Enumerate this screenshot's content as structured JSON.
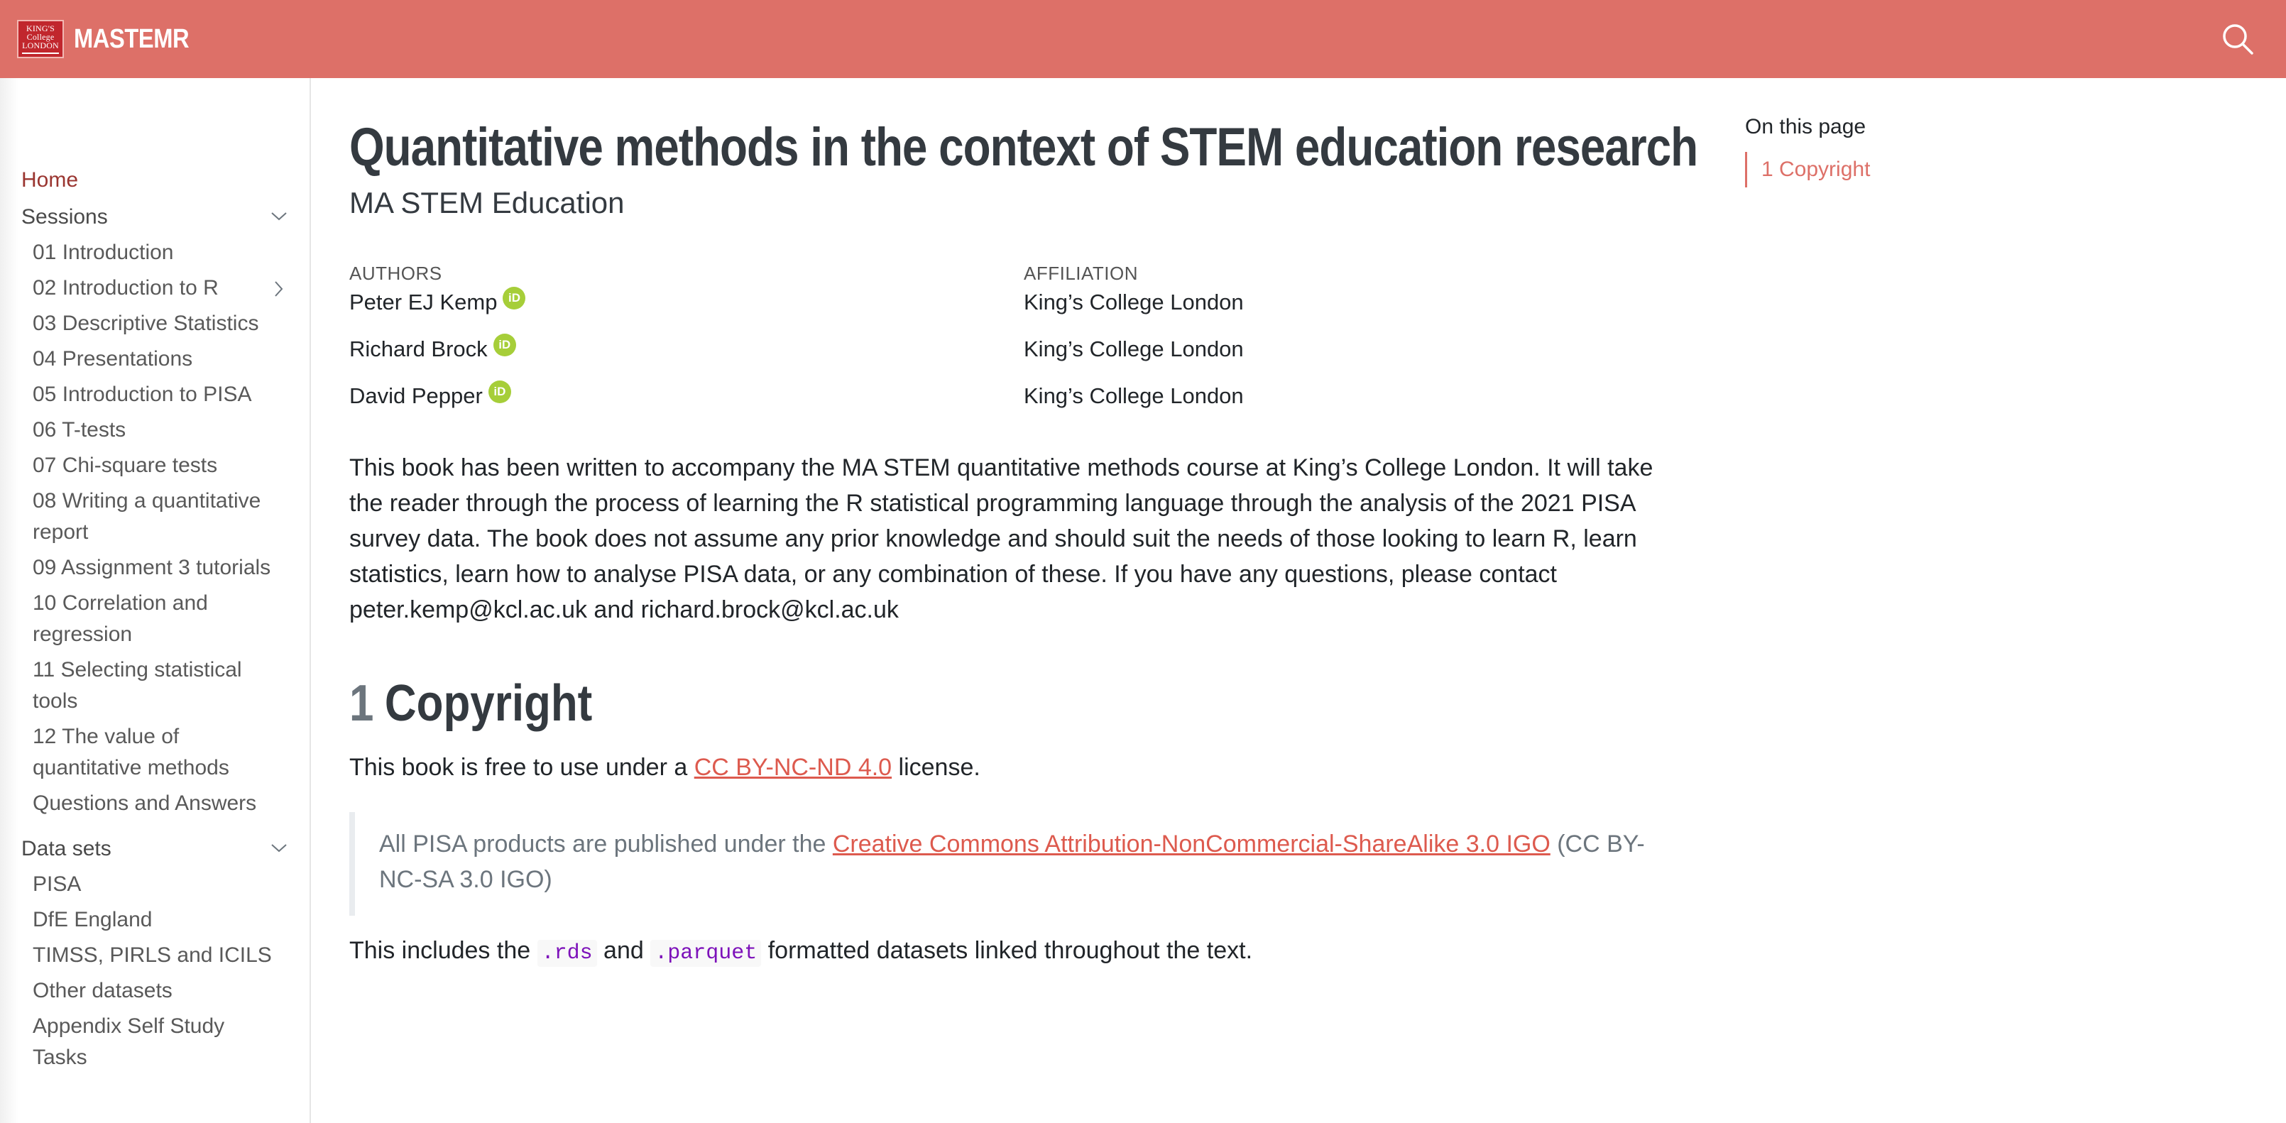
{
  "navbar": {
    "logo_lines": [
      "KING'S",
      "College",
      "LONDON"
    ],
    "brand": "MASTEMR",
    "search_icon": "search-icon"
  },
  "sidebar": {
    "home": "Home",
    "sessions_label": "Sessions",
    "sessions": [
      "01 Introduction",
      "02 Introduction to R",
      "03 Descriptive Statistics",
      "04 Presentations",
      "05 Introduction to PISA",
      "06 T-tests",
      "07 Chi-square tests",
      "08 Writing a quantitative report",
      "09 Assignment 3 tutorials",
      "10 Correlation and regression",
      "11 Selecting statistical tools",
      "12 The value of quantitative methods",
      "Questions and Answers"
    ],
    "datasets_label": "Data sets",
    "datasets": [
      "PISA",
      "DfE England",
      "TIMSS, PIRLS and ICILS",
      "Other datasets",
      "Appendix Self Study Tasks"
    ]
  },
  "main": {
    "title": "Quantitative methods in the context of STEM education research",
    "subtitle": "MA STEM Education",
    "authors_heading": "AUTHORS",
    "affiliation_heading": "AFFILIATION",
    "authors": [
      {
        "name": "Peter EJ Kemp",
        "affiliation": "King’s College London"
      },
      {
        "name": "Richard Brock",
        "affiliation": "King’s College London"
      },
      {
        "name": "David Pepper",
        "affiliation": "King’s College London"
      }
    ],
    "orcid_label": "iD",
    "intro": "This book has been written to accompany the MA STEM quantitative methods course at King’s College London. It will take the reader through the process of learning the R statistical programming language through the analysis of the 2021 PISA survey data. The book does not assume any prior knowledge and should suit the needs of those looking to learn R, learn statistics, learn how to analyse PISA data, or any combination of these. If you have any questions, please contact peter.kemp@kcl.ac.uk and richard.brock@kcl.ac.uk",
    "copyright_number": "1",
    "copyright_heading": "Copyright",
    "license_prefix": "This book is free to use under a ",
    "license_link": "CC BY-NC-ND 4.0",
    "license_suffix": " license.",
    "quote_prefix": "All PISA products are published under the ",
    "quote_link": "Creative Commons Attribution-NonCommercial-ShareAlike 3.0 IGO",
    "quote_suffix": " (CC BY-NC-SA 3.0 IGO)",
    "includes_prefix": "This includes the ",
    "code_rds": ".rds",
    "includes_and": " and ",
    "code_parquet": ".parquet",
    "includes_suffix": " formatted datasets linked throughout the text."
  },
  "toc": {
    "title": "On this page",
    "items": [
      "1 Copyright"
    ]
  },
  "colors": {
    "navbar": "#dd7068",
    "link": "#dd5a4e",
    "home": "#9a3530",
    "orcid": "#a6ce39",
    "code": "#7d12ba"
  }
}
